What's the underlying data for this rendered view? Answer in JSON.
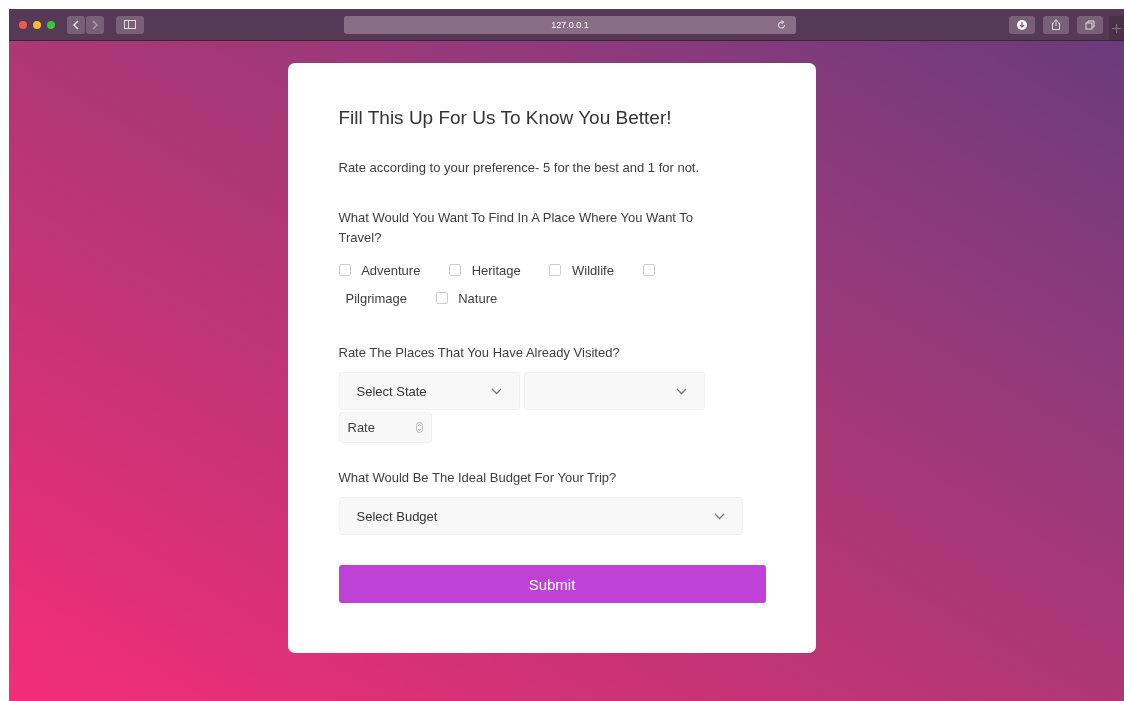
{
  "browser": {
    "url": "127.0.0.1"
  },
  "form": {
    "title": "Fill This Up For Us To Know You Better!",
    "instruction": "Rate according to your preference- 5 for the best and 1 for not.",
    "questions": [
      {
        "kind": "checkboxes",
        "label": "What Would You Want To Find In A Place Where You Want To Travel?",
        "options": [
          {
            "label": "Adventure",
            "checked": false
          },
          {
            "label": "Heritage",
            "checked": false
          },
          {
            "label": "Wildlife",
            "checked": false
          },
          {
            "label": "Pilgrimage",
            "checked": false
          },
          {
            "label": "Nature",
            "checked": false
          }
        ]
      },
      {
        "kind": "rating",
        "label": "Rate The Places That You Have Already Visited?",
        "state_select": {
          "placeholder": "Select State"
        },
        "rate": {
          "placeholder": "Rate"
        }
      },
      {
        "kind": "select",
        "label": "What Would Be The Ideal Budget For Your Trip?",
        "select": {
          "placeholder": "Select Budget"
        }
      }
    ],
    "submit": "Submit"
  }
}
